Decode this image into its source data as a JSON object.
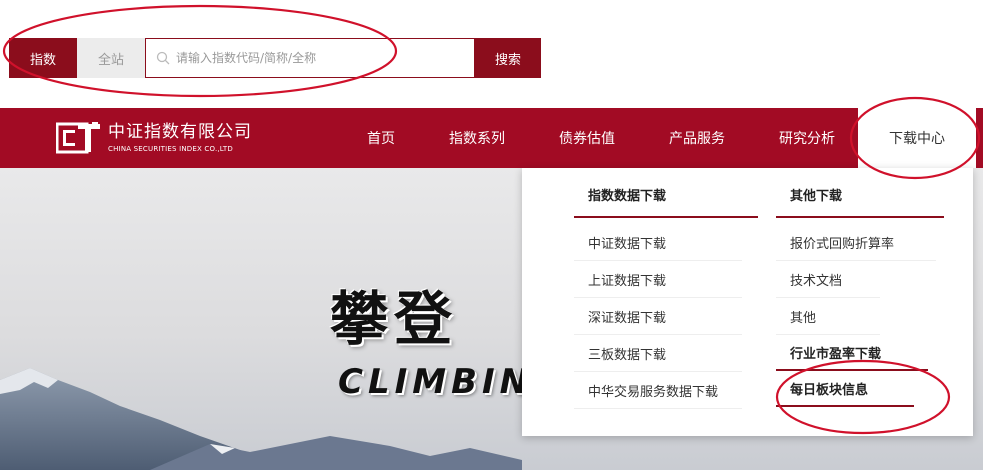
{
  "search": {
    "scope_index": "指数",
    "scope_site": "全站",
    "placeholder": "请输入指数代码/简称/全称",
    "button_label": "搜索"
  },
  "brand": {
    "name_cn": "中证指数有限公司",
    "name_en": "CHINA SECURITIES INDEX CO.,LTD"
  },
  "nav": {
    "items": [
      "首页",
      "指数系列",
      "债券估值",
      "产品服务",
      "研究分析",
      "下载中心"
    ],
    "active_index": 5
  },
  "hero": {
    "title_cn": "攀登",
    "title_en": "CLIMBIN"
  },
  "dropdown": {
    "columns": [
      {
        "heading": "指数数据下载",
        "items": [
          "中证数据下载",
          "上证数据下载",
          "深证数据下载",
          "三板数据下载",
          "中华交易服务数据下载"
        ]
      },
      {
        "heading": "其他下载",
        "items": [
          "报价式回购折算率",
          "技术文档",
          "其他"
        ],
        "bold_items": [
          "行业市盈率下载",
          "每日板块信息"
        ]
      }
    ]
  },
  "colors": {
    "brand_red": "#a20b24",
    "dark_red": "#8b0d1c",
    "annotation_red": "#d0112b"
  },
  "icons": [
    "search-icon",
    "logo-mark"
  ]
}
